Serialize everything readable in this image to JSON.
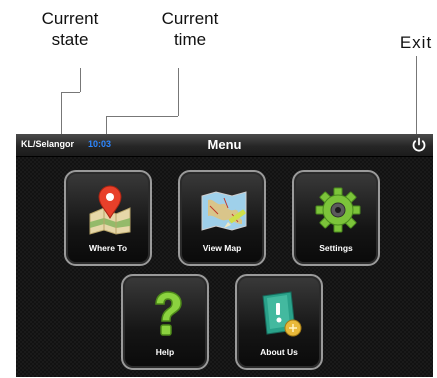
{
  "callouts": {
    "current_state": [
      "Current",
      "state"
    ],
    "current_time": [
      "Current",
      "time"
    ],
    "exit": "Exit"
  },
  "topbar": {
    "state": "KL/Selangor",
    "time": "10:03",
    "title": "Menu",
    "exit_icon": "power-icon"
  },
  "menu": [
    {
      "label": "Where To",
      "icon": "map-pin-icon"
    },
    {
      "label": "View Map",
      "icon": "map-icon"
    },
    {
      "label": "Settings",
      "icon": "gear-icon"
    },
    {
      "label": "Help",
      "icon": "question-mark-icon"
    },
    {
      "label": "About Us",
      "icon": "info-icon"
    }
  ],
  "colors": {
    "time_text": "#2c86ff",
    "pin": "#e8402a",
    "gear": "#7cc43a",
    "help": "#8bd23f",
    "about": "#2aa28a"
  }
}
